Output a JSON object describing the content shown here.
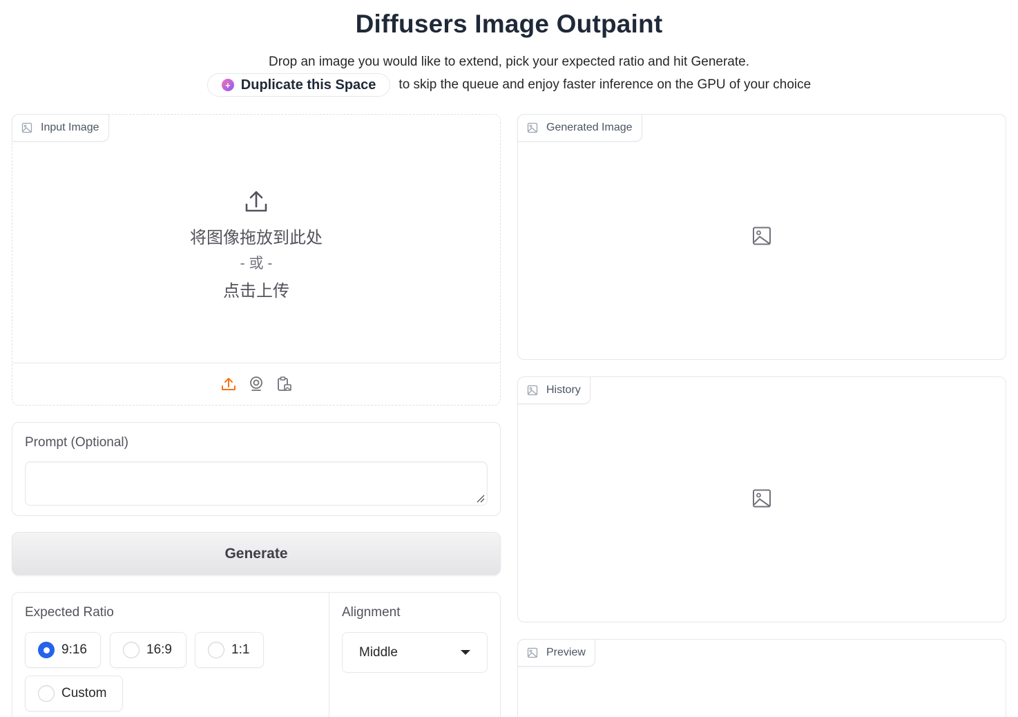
{
  "header": {
    "title": "Diffusers Image Outpaint",
    "description": "Drop an image you would like to extend, pick your expected ratio and hit Generate.",
    "duplicate_button": "Duplicate this Space",
    "duplicate_text": "to skip the queue and enjoy faster inference on the GPU of your choice"
  },
  "input_image": {
    "label": "Input Image",
    "drop_text": "将图像拖放到此处",
    "or_text": "- 或 -",
    "click_text": "点击上传",
    "tools": [
      "upload-icon",
      "webcam-icon",
      "clipboard-icon"
    ],
    "accent_color": "#f97316"
  },
  "prompt": {
    "label": "Prompt (Optional)",
    "value": ""
  },
  "generate_button": "Generate",
  "expected_ratio": {
    "label": "Expected Ratio",
    "options": [
      "9:16",
      "16:9",
      "1:1",
      "Custom"
    ],
    "selected": "9:16",
    "selected_color": "#2563eb"
  },
  "alignment": {
    "label": "Alignment",
    "value": "Middle"
  },
  "generated_image": {
    "label": "Generated Image"
  },
  "history": {
    "label": "History"
  },
  "preview": {
    "label": "Preview"
  }
}
